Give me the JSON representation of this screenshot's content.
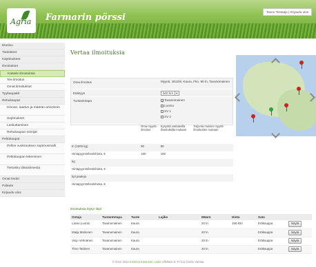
{
  "header": {
    "logo_text": "Agria",
    "site_title": "Farmarin pörssi",
    "user_text": "Tauno Testaaja | Kirjaudu ulos"
  },
  "sidebar": {
    "items": [
      {
        "label": "Etusivu",
        "kind": "section"
      },
      {
        "label": "Tiedotteet",
        "kind": "section"
      },
      {
        "label": "Käyttöoikeet",
        "kind": "section"
      },
      {
        "label": "Ilmoitukset",
        "kind": "section"
      },
      {
        "label": "Katsele ilmoituksia",
        "kind": "sub-active"
      },
      {
        "label": "Tee ilmoitus",
        "kind": "sub"
      },
      {
        "label": "Omat ilmoitukset",
        "kind": "sub"
      },
      {
        "label": "Tyykaupakit",
        "kind": "section"
      },
      {
        "label": "Rehukaupat",
        "kind": "section"
      },
      {
        "label": "Hinnan, laadun ja määrän arvioinnin",
        "kind": "sub-two"
      },
      {
        "label": "Sopimukset",
        "kind": "sub"
      },
      {
        "label": "Laskuttaminen",
        "kind": "sub"
      },
      {
        "label": "Rehukaupan toimijat",
        "kind": "sub"
      },
      {
        "label": "Peltokaupat",
        "kind": "section"
      },
      {
        "label": "Pellon vuokrauksen sopimusmalli",
        "kind": "sub-two"
      },
      {
        "label": "Peltokaupan tekeminen",
        "kind": "sub-two"
      },
      {
        "label": "Tietoisku tilatuloksesta",
        "kind": "sub-two"
      },
      {
        "label": "Omat tiedot",
        "kind": "section"
      },
      {
        "label": "Palaute",
        "kind": "section"
      },
      {
        "label": "Kirjaudu ulos",
        "kind": "section"
      }
    ]
  },
  "page_title": "Vertaa ilmoituksia",
  "info": {
    "own_label": "Oma ilmoitus",
    "own_value": "Myynti, 2012/8, Kaura, Fko. 90 tn, Tavanomainen",
    "distance_label": "Etäisyys",
    "distance_value": "500 km",
    "method_label": "Tuotantotapa",
    "methods": [
      "Tavanomainen",
      "Luomu",
      "SV 1",
      "SV 2"
    ]
  },
  "price_table": {
    "headers": [
      "Oma myynti-ilmoitus",
      "Kysyntä vastaavilla ilmoituksilla mukaan",
      "Tarjonta muiden myynti-ilmoitusten mukaan"
    ],
    "rows": [
      {
        "label": "tn (1000 kg)",
        "values": [
          "90",
          "80",
          ""
        ]
      },
      {
        "label": "Hintapyyntö/keskihinta, €",
        "values": [
          "180",
          "150",
          ""
        ]
      },
      {
        "label": "kg",
        "values": [
          "",
          "",
          ""
        ]
      },
      {
        "label": "Hintapyyntö/keskihinta, €",
        "values": [
          "",
          "",
          ""
        ]
      },
      {
        "label": "kpl paaleja",
        "values": [
          "",
          "",
          ""
        ]
      },
      {
        "label": "Hintapyyntö/keskihinta, €",
        "values": [
          "",
          "",
          ""
        ]
      }
    ]
  },
  "listings": {
    "title": "Ilmoituksia löytyi 4kpl",
    "columns": [
      "Ostaja",
      "Tuotantotapa",
      "Tuote",
      "Lajike",
      "Määrä",
      "Hinta",
      "Sato",
      ""
    ],
    "button_label": "Näytä",
    "rows": [
      {
        "buyer": "Lasse Luonto",
        "method": "Tavanomainen",
        "product": "Kaura",
        "variety": "",
        "amount": "20 tn",
        "price": "150 €/tn",
        "harvest": "Eräkauppa"
      },
      {
        "buyer": "Maija Maitonen",
        "method": "Tavanomainen",
        "product": "Kaura",
        "variety": "",
        "amount": "20 tn",
        "price": "",
        "harvest": "Eräkauppa"
      },
      {
        "buyer": "Veijo Vehnänen",
        "method": "Tavanomainen",
        "product": "Kaura",
        "variety": "",
        "amount": "20 tn",
        "price": "",
        "harvest": "Eräkauppa"
      },
      {
        "buyer": "Timo Tattinen",
        "method": "Tavanomainen",
        "product": "Kaura",
        "variety": "",
        "amount": "20 tn",
        "price": "",
        "harvest": "Eräkauppa"
      }
    ]
  },
  "footer": {
    "prefix": "© 2012 2014",
    "link": "Kristiina Kastusten Uutis",
    "suffix": "Uffellutie 6, FI-211 01201 Vantaa"
  },
  "icons": {
    "map_up": "chevron-up-icon",
    "map_down": "chevron-down-icon",
    "map_left": "chevron-left-icon",
    "map_right": "chevron-right-icon",
    "pin": "map-pin-icon"
  },
  "colors": {
    "brand_green": "#6fa534",
    "title_green": "#3e6e1e",
    "pin_red": "#d0211b",
    "pin_green": "#2ea043"
  }
}
